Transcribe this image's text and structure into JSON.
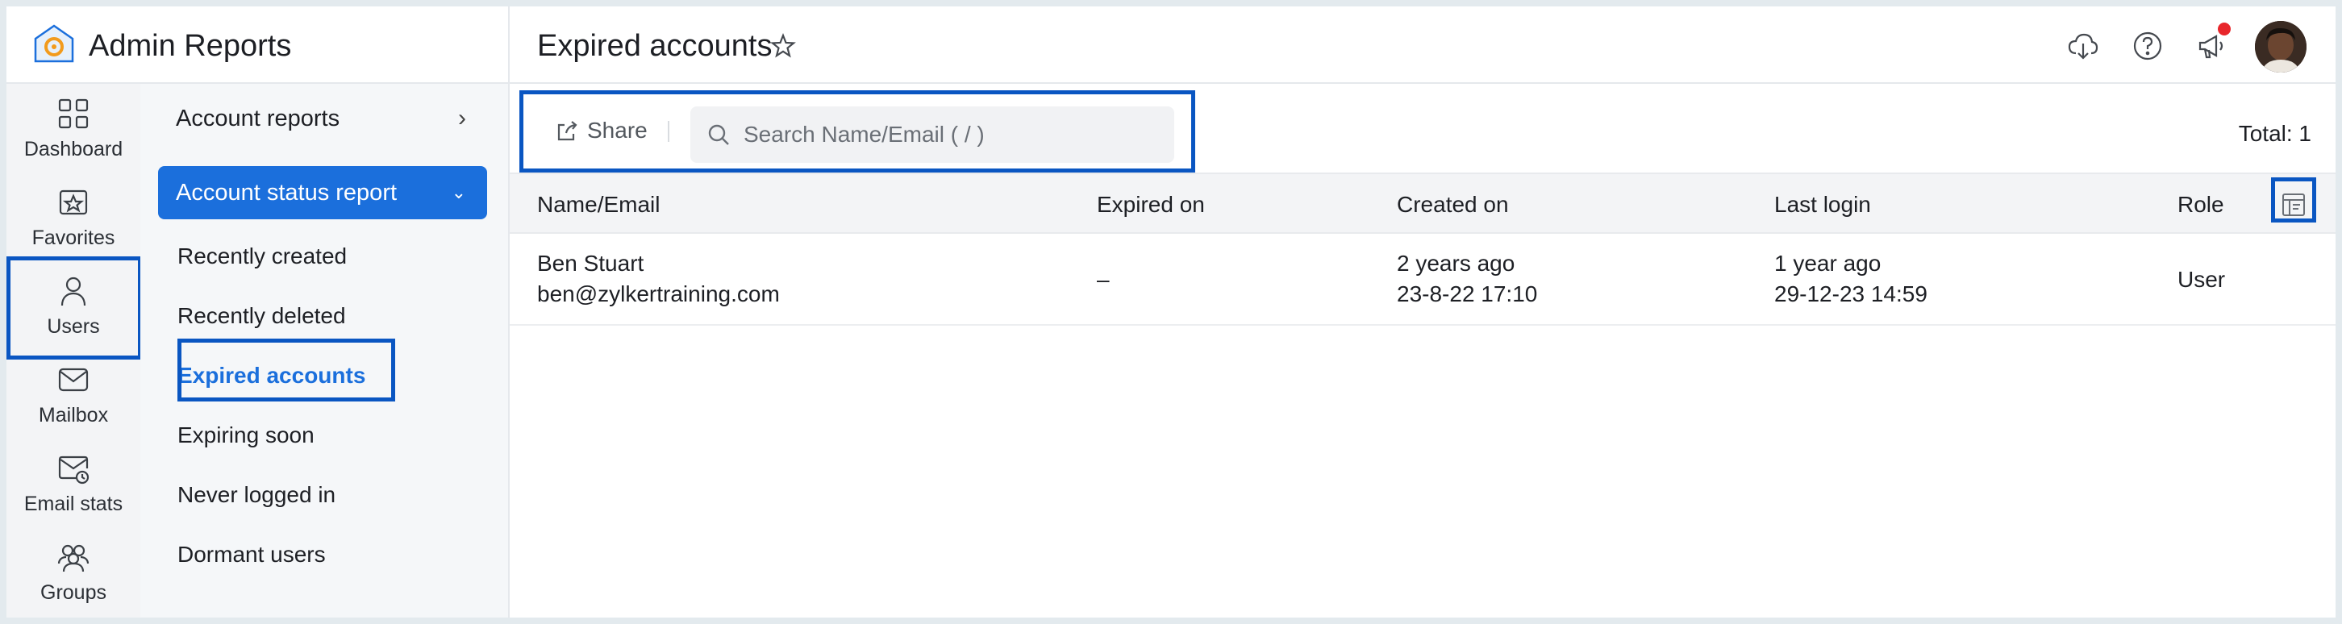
{
  "app": {
    "title": "Admin Reports"
  },
  "nav_rail": [
    {
      "label": "Dashboard",
      "icon": "dashboard-icon"
    },
    {
      "label": "Favorites",
      "icon": "favorites-icon"
    },
    {
      "label": "Users",
      "icon": "user-icon",
      "active": true
    },
    {
      "label": "Mailbox",
      "icon": "mailbox-icon"
    },
    {
      "label": "Email stats",
      "icon": "email-stats-icon"
    },
    {
      "label": "Groups",
      "icon": "groups-icon"
    }
  ],
  "submenu": {
    "account_reports": "Account reports",
    "account_status_report": "Account status report",
    "items": [
      "Recently created",
      "Recently deleted",
      "Expired accounts",
      "Expiring soon",
      "Never logged in",
      "Dormant users"
    ],
    "selected": "Expired accounts"
  },
  "header": {
    "title": "Expired accounts"
  },
  "toolbar": {
    "share_label": "Share",
    "search_placeholder": "Search Name/Email ( / )",
    "total": "Total: 1"
  },
  "table": {
    "columns": [
      "Name/Email",
      "Expired on",
      "Created on",
      "Last login",
      "Role"
    ],
    "rows": [
      {
        "name": "Ben Stuart",
        "email": "ben@zylkertraining.com",
        "expired_on": "–",
        "created_relative": "2 years ago",
        "created_on": "23-8-22 17:10",
        "last_login_relative": "1 year ago",
        "last_login": "29-12-23 14:59",
        "role": "User"
      }
    ]
  },
  "colors": {
    "accent": "#1b6fdc",
    "highlight": "#0a56c2",
    "notification": "#e8262b"
  }
}
